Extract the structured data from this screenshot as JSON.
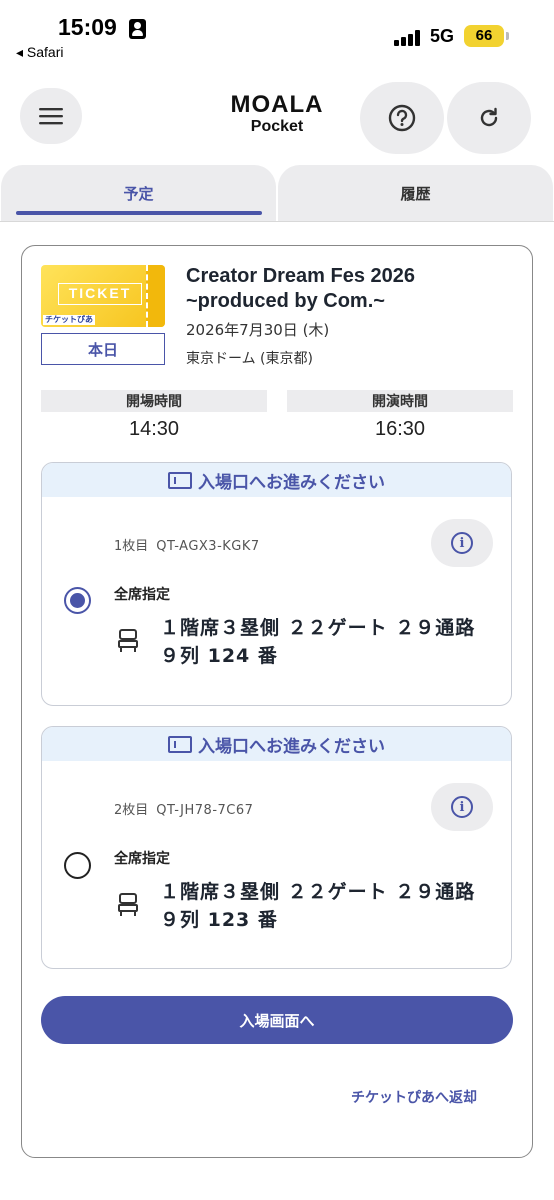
{
  "status_bar": {
    "time": "15:09",
    "back_label": "◂ Safari",
    "network": "5G",
    "battery": "66",
    "icons": [
      "person-badge-icon",
      "signal-icon",
      "battery-icon"
    ]
  },
  "header": {
    "logo_main": "MOALA",
    "logo_sub": "Pocket",
    "icons": {
      "menu": "hamburger-icon",
      "help": "question-circle-icon",
      "reload": "refresh-icon"
    }
  },
  "tabs": [
    {
      "label": "予定",
      "active": true
    },
    {
      "label": "履歴",
      "active": false
    }
  ],
  "event": {
    "ticket_image_text": "TICKET",
    "ticket_brand": "チケットぴあ",
    "today_badge": "本日",
    "title_line1": "Creator Dream Fes 2026",
    "title_line2": "~produced by Com.~",
    "date": "2026年7月30日 (木)",
    "venue": "東京ドーム (東京都)",
    "open_label": "開場時間",
    "open_time": "14:30",
    "start_label": "開演時間",
    "start_time": "16:30"
  },
  "tickets": [
    {
      "banner": "入場口へお進みください",
      "index": "1枚目",
      "code": "QT-AGX3-KGK7",
      "selected": true,
      "seat_type": "全席指定",
      "seat_line1": "１階席３塁側 ２２ゲート ２９通路",
      "seat_line2": "９列 124 番"
    },
    {
      "banner": "入場口へお進みください",
      "index": "2枚目",
      "code": "QT-JH78-7C67",
      "selected": false,
      "seat_type": "全席指定",
      "seat_line1": "１階席３塁側 ２２ゲート ２９通路",
      "seat_line2": "９列 123 番"
    }
  ],
  "actions": {
    "enter_button": "入場画面へ",
    "return_link": "チケットぴあへ返却"
  },
  "colors": {
    "accent": "#4a55a8",
    "banner_bg": "#e7f1fb",
    "button_bg": "#ececee"
  }
}
